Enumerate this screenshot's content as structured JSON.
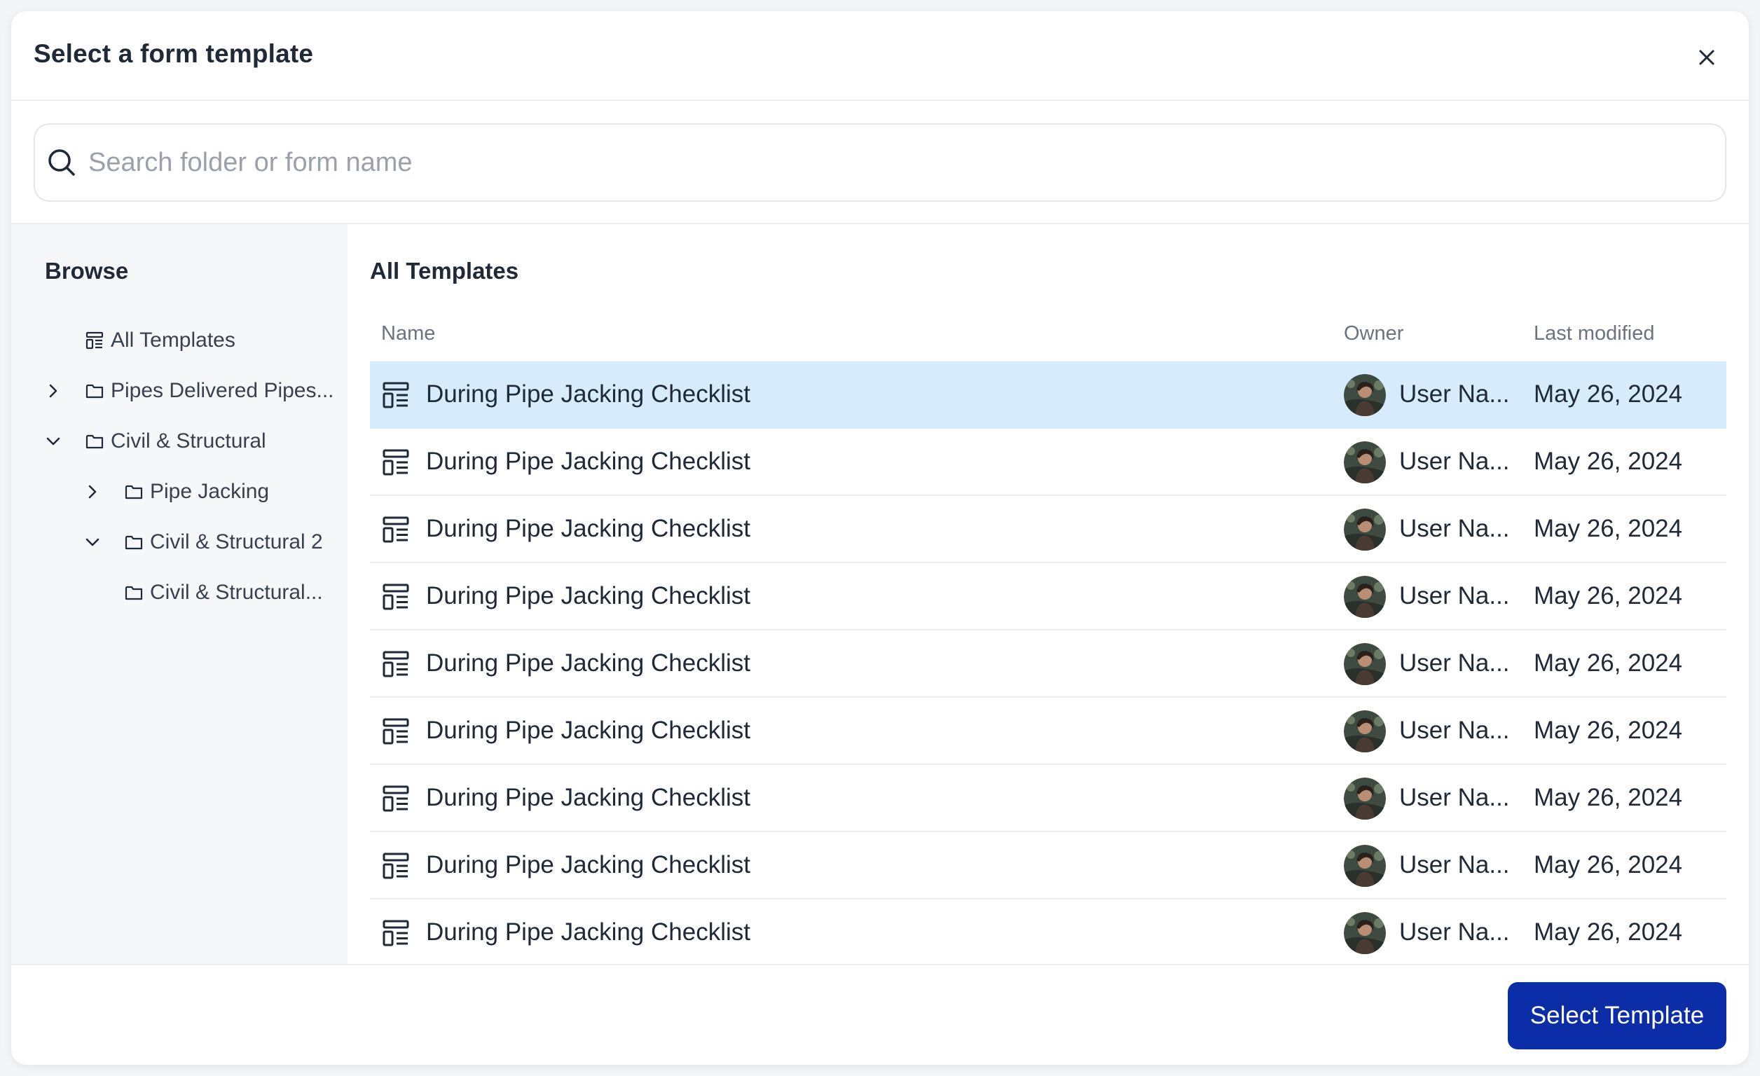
{
  "dialog": {
    "title": "Select a form template"
  },
  "search": {
    "placeholder": "Search folder or form name",
    "value": ""
  },
  "sidebar": {
    "title": "Browse",
    "items": [
      {
        "label": "All Templates",
        "icon": "form-template-icon",
        "chevron": "none",
        "level": 1
      },
      {
        "label": "Pipes Delivered Pipes...",
        "icon": "folder-icon",
        "chevron": "right",
        "level": 1
      },
      {
        "label": "Civil & Structural",
        "icon": "folder-icon",
        "chevron": "down",
        "level": 1
      },
      {
        "label": "Pipe Jacking",
        "icon": "folder-icon",
        "chevron": "right",
        "level": 2
      },
      {
        "label": "Civil & Structural 2",
        "icon": "folder-icon",
        "chevron": "down",
        "level": 2
      },
      {
        "label": "Civil & Structural...",
        "icon": "folder-icon",
        "chevron": "none",
        "level": 3
      }
    ]
  },
  "main": {
    "title": "All Templates",
    "columns": [
      "Name",
      "Owner",
      "Last modified"
    ],
    "rows": [
      {
        "name": "During Pipe Jacking Checklist",
        "owner": "User Na...",
        "modified": "May 26, 2024",
        "selected": true
      },
      {
        "name": "During Pipe Jacking Checklist",
        "owner": "User Na...",
        "modified": "May 26, 2024",
        "selected": false
      },
      {
        "name": "During Pipe Jacking Checklist",
        "owner": "User Na...",
        "modified": "May 26, 2024",
        "selected": false
      },
      {
        "name": "During Pipe Jacking Checklist",
        "owner": "User Na...",
        "modified": "May 26, 2024",
        "selected": false
      },
      {
        "name": "During Pipe Jacking Checklist",
        "owner": "User Na...",
        "modified": "May 26, 2024",
        "selected": false
      },
      {
        "name": "During Pipe Jacking Checklist",
        "owner": "User Na...",
        "modified": "May 26, 2024",
        "selected": false
      },
      {
        "name": "During Pipe Jacking Checklist",
        "owner": "User Na...",
        "modified": "May 26, 2024",
        "selected": false
      },
      {
        "name": "During Pipe Jacking Checklist",
        "owner": "User Na...",
        "modified": "May 26, 2024",
        "selected": false
      },
      {
        "name": "During Pipe Jacking Checklist",
        "owner": "User Na...",
        "modified": "May 26, 2024",
        "selected": false
      }
    ]
  },
  "footer": {
    "primary_label": "Select Template"
  },
  "colors": {
    "accent": "#0b2ea8",
    "selected_row": "#d6ecfd",
    "sidebar_bg": "#f6f7f9"
  }
}
